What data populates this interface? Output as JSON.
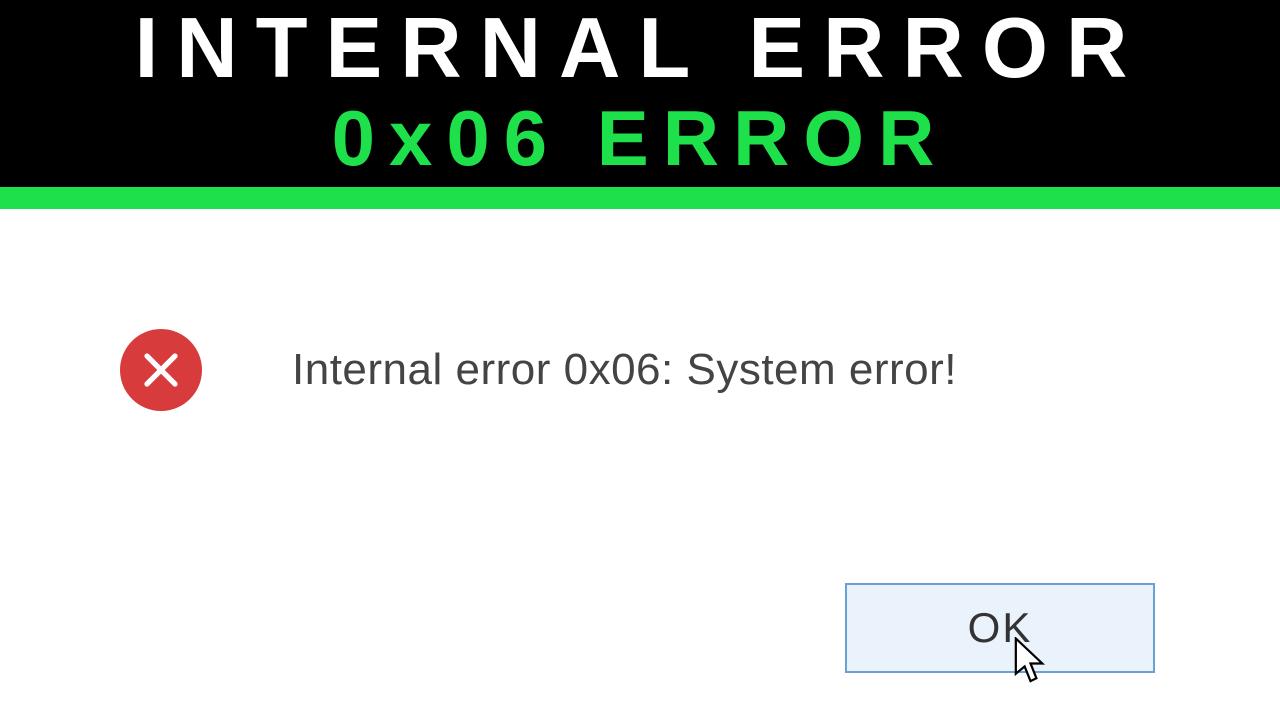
{
  "banner": {
    "line1": "INTERNAL ERROR",
    "line2": "0x06 ERROR"
  },
  "dialog": {
    "message": "Internal error 0x06: System error!",
    "ok_label": "OK"
  },
  "colors": {
    "accent_green": "#1ee04b",
    "error_red": "#d83b3b",
    "button_border": "#6aa0d6",
    "button_bg": "#eaf2fb"
  }
}
